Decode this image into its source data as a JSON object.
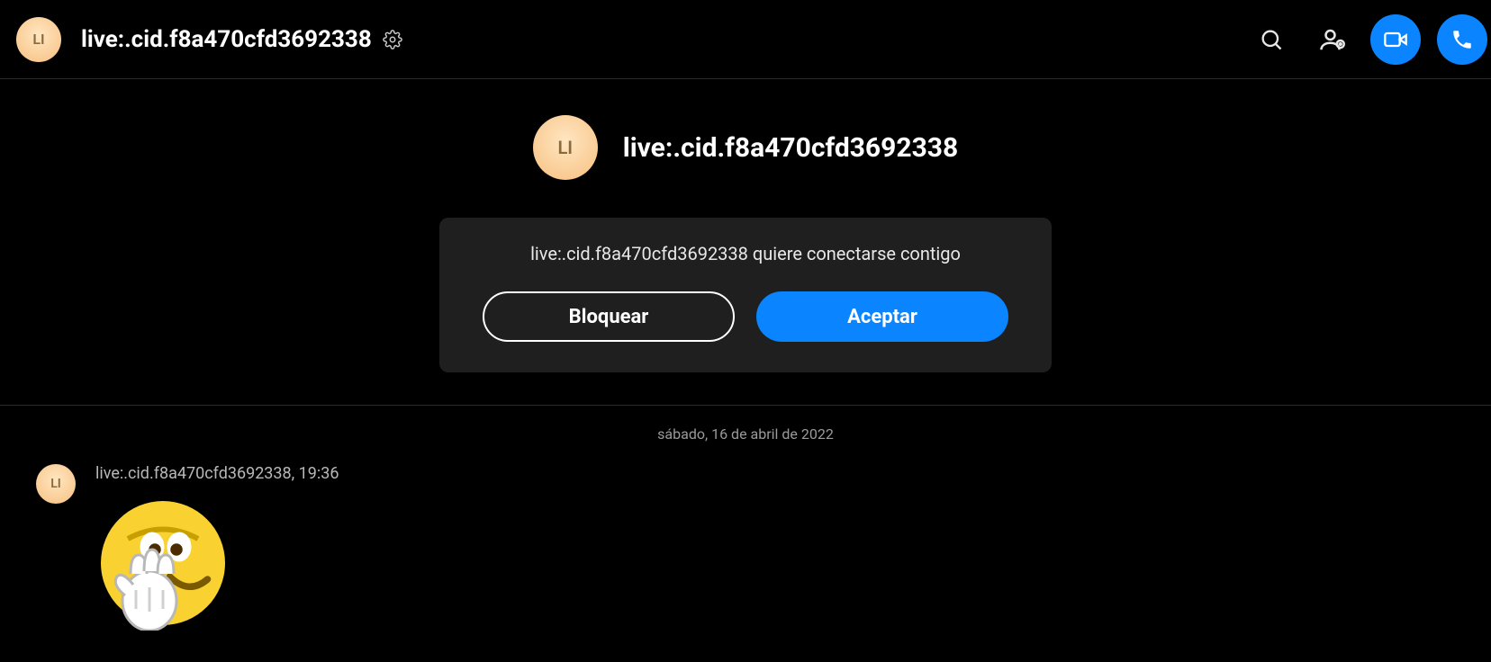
{
  "header": {
    "avatar_initials": "LI",
    "title": "live:.cid.f8a470cfd3692338"
  },
  "invite": {
    "avatar_initials": "LI",
    "username": "live:.cid.f8a470cfd3692338",
    "message": "live:.cid.f8a470cfd3692338 quiere conectarse contigo",
    "block_label": "Bloquear",
    "accept_label": "Aceptar"
  },
  "messages": {
    "date_label": "sábado, 16 de abril de 2022",
    "items": [
      {
        "avatar_initials": "LI",
        "meta": "live:.cid.f8a470cfd3692338, 19:36"
      }
    ]
  },
  "colors": {
    "accent": "#0a84ff",
    "card_bg": "#1f1f1f"
  }
}
